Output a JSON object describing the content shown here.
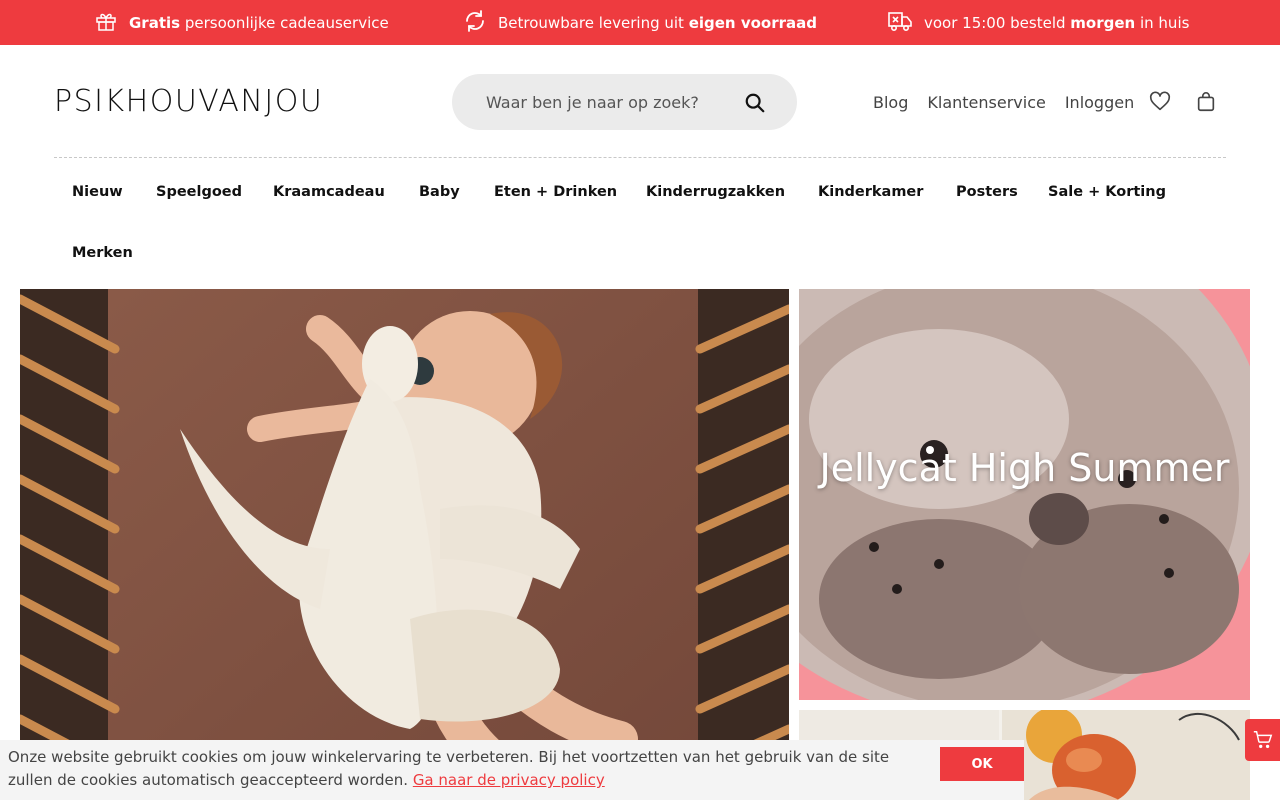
{
  "usp_bar": {
    "items": [
      {
        "bold": "Gratis",
        "text": " persoonlijke cadeauservice",
        "icon": "gift-icon"
      },
      {
        "text_before": "Betrouwbare levering uit ",
        "bold": "eigen voorraad",
        "icon": "refresh-icon"
      },
      {
        "text_before": "voor 15:00 besteld ",
        "bold": "morgen",
        "text_after": " in huis",
        "icon": "delivery-truck-icon"
      }
    ]
  },
  "header": {
    "logo": "PSIKHOUVANJOU",
    "search_placeholder": "Waar ben je naar op zoek?",
    "links": [
      "Blog",
      "Klantenservice",
      "Inloggen"
    ],
    "icons": [
      "heart-icon",
      "shopping-bag-icon"
    ]
  },
  "nav": {
    "items": [
      "Nieuw",
      "Speelgoed",
      "Kraamcadeau",
      "Baby",
      "Eten + Drinken",
      "Kinderrugzakken",
      "Kinderkamer",
      "Posters",
      "Sale + Korting",
      "Merken"
    ]
  },
  "hero": {
    "right_title": "Jellycat High Summer"
  },
  "cookie": {
    "text": "Onze website gebruikt cookies om jouw winkelervaring te verbeteren. Bij het voortzetten van het gebruik van de site zullen de cookies automatisch geaccepteerd worden. ",
    "link": "Ga naar de privacy policy",
    "ok": "OK"
  },
  "colors": {
    "accent": "#ee3b3f",
    "search_bg": "#ebebeb",
    "cookie_bg": "#f4f4f4"
  }
}
